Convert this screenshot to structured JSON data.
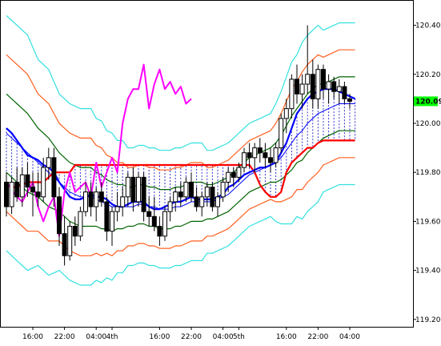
{
  "chart_data": {
    "type": "candlestick",
    "y_axis": {
      "ylim": [
        119.17,
        120.5
      ],
      "ticks": [
        "120.40",
        "120.20",
        "120.00",
        "119.80",
        "119.60",
        "119.40",
        "119.20"
      ]
    },
    "x_axis": {
      "tick_labels": [
        {
          "label": "16:00",
          "i": 5
        },
        {
          "label": "22:00",
          "i": 11
        },
        {
          "label": "04:00",
          "i": 17
        },
        {
          "label": "4th",
          "i": 20
        },
        {
          "label": "16:00",
          "i": 29
        },
        {
          "label": "22:00",
          "i": 35
        },
        {
          "label": "04:00",
          "i": 41
        },
        {
          "label": "5th",
          "i": 44
        },
        {
          "label": "16:00",
          "i": 53
        },
        {
          "label": "22:00",
          "i": 59
        },
        {
          "label": "04:00",
          "i": 65
        }
      ]
    },
    "current_price": {
      "label": "120.09",
      "value": 120.09,
      "color": "#00ff00"
    },
    "colors": {
      "up_candle": "#ffffff",
      "down_candle": "#000000",
      "conversion_line": "#0000ff",
      "base_line": "#ff0000",
      "lagging_span": "#ff00ff",
      "sma": "#0000ff",
      "band_1sigma": "#006400",
      "band_2sigma": "#ff6020",
      "band_3sigma": "#33e0e0",
      "cloud_hatch": "#3333cc"
    },
    "candles": [
      {
        "o": 119.76,
        "h": 119.8,
        "l": 119.62,
        "c": 119.66
      },
      {
        "o": 119.66,
        "h": 119.78,
        "l": 119.63,
        "c": 119.76
      },
      {
        "o": 119.76,
        "h": 119.82,
        "l": 119.68,
        "c": 119.7
      },
      {
        "o": 119.7,
        "h": 119.82,
        "l": 119.66,
        "c": 119.79
      },
      {
        "o": 119.79,
        "h": 119.84,
        "l": 119.7,
        "c": 119.74
      },
      {
        "o": 119.74,
        "h": 119.8,
        "l": 119.62,
        "c": 119.72
      },
      {
        "o": 119.72,
        "h": 119.8,
        "l": 119.66,
        "c": 119.7
      },
      {
        "o": 119.7,
        "h": 119.86,
        "l": 119.68,
        "c": 119.82
      },
      {
        "o": 119.82,
        "h": 119.9,
        "l": 119.77,
        "c": 119.86
      },
      {
        "o": 119.86,
        "h": 119.9,
        "l": 119.66,
        "c": 119.7
      },
      {
        "o": 119.7,
        "h": 119.74,
        "l": 119.5,
        "c": 119.55
      },
      {
        "o": 119.55,
        "h": 119.62,
        "l": 119.42,
        "c": 119.46
      },
      {
        "o": 119.46,
        "h": 119.6,
        "l": 119.44,
        "c": 119.58
      },
      {
        "o": 119.58,
        "h": 119.62,
        "l": 119.5,
        "c": 119.54
      },
      {
        "o": 119.54,
        "h": 119.66,
        "l": 119.52,
        "c": 119.64
      },
      {
        "o": 119.64,
        "h": 119.76,
        "l": 119.62,
        "c": 119.72
      },
      {
        "o": 119.72,
        "h": 119.76,
        "l": 119.62,
        "c": 119.66
      },
      {
        "o": 119.66,
        "h": 119.74,
        "l": 119.6,
        "c": 119.72
      },
      {
        "o": 119.72,
        "h": 119.76,
        "l": 119.66,
        "c": 119.68
      },
      {
        "o": 119.68,
        "h": 119.7,
        "l": 119.52,
        "c": 119.56
      },
      {
        "o": 119.56,
        "h": 119.66,
        "l": 119.5,
        "c": 119.64
      },
      {
        "o": 119.64,
        "h": 119.72,
        "l": 119.6,
        "c": 119.66
      },
      {
        "o": 119.66,
        "h": 119.74,
        "l": 119.62,
        "c": 119.7
      },
      {
        "o": 119.7,
        "h": 119.8,
        "l": 119.66,
        "c": 119.78
      },
      {
        "o": 119.78,
        "h": 119.82,
        "l": 119.64,
        "c": 119.68
      },
      {
        "o": 119.68,
        "h": 119.8,
        "l": 119.66,
        "c": 119.78
      },
      {
        "o": 119.78,
        "h": 119.8,
        "l": 119.6,
        "c": 119.64
      },
      {
        "o": 119.64,
        "h": 119.7,
        "l": 119.58,
        "c": 119.62
      },
      {
        "o": 119.62,
        "h": 119.7,
        "l": 119.56,
        "c": 119.58
      },
      {
        "o": 119.58,
        "h": 119.62,
        "l": 119.5,
        "c": 119.54
      },
      {
        "o": 119.54,
        "h": 119.66,
        "l": 119.52,
        "c": 119.64
      },
      {
        "o": 119.64,
        "h": 119.7,
        "l": 119.6,
        "c": 119.68
      },
      {
        "o": 119.68,
        "h": 119.74,
        "l": 119.64,
        "c": 119.72
      },
      {
        "o": 119.72,
        "h": 119.76,
        "l": 119.66,
        "c": 119.7
      },
      {
        "o": 119.7,
        "h": 119.78,
        "l": 119.68,
        "c": 119.76
      },
      {
        "o": 119.76,
        "h": 119.8,
        "l": 119.68,
        "c": 119.7
      },
      {
        "o": 119.7,
        "h": 119.74,
        "l": 119.64,
        "c": 119.66
      },
      {
        "o": 119.66,
        "h": 119.72,
        "l": 119.62,
        "c": 119.7
      },
      {
        "o": 119.7,
        "h": 119.76,
        "l": 119.66,
        "c": 119.74
      },
      {
        "o": 119.74,
        "h": 119.76,
        "l": 119.64,
        "c": 119.66
      },
      {
        "o": 119.66,
        "h": 119.72,
        "l": 119.62,
        "c": 119.7
      },
      {
        "o": 119.7,
        "h": 119.78,
        "l": 119.68,
        "c": 119.76
      },
      {
        "o": 119.76,
        "h": 119.82,
        "l": 119.72,
        "c": 119.8
      },
      {
        "o": 119.8,
        "h": 119.82,
        "l": 119.74,
        "c": 119.78
      },
      {
        "o": 119.78,
        "h": 119.84,
        "l": 119.76,
        "c": 119.82
      },
      {
        "o": 119.82,
        "h": 119.9,
        "l": 119.8,
        "c": 119.88
      },
      {
        "o": 119.88,
        "h": 119.92,
        "l": 119.82,
        "c": 119.86
      },
      {
        "o": 119.86,
        "h": 119.92,
        "l": 119.8,
        "c": 119.9
      },
      {
        "o": 119.9,
        "h": 119.94,
        "l": 119.84,
        "c": 119.88
      },
      {
        "o": 119.88,
        "h": 119.92,
        "l": 119.82,
        "c": 119.86
      },
      {
        "o": 119.86,
        "h": 119.9,
        "l": 119.8,
        "c": 119.84
      },
      {
        "o": 119.84,
        "h": 119.92,
        "l": 119.82,
        "c": 119.9
      },
      {
        "o": 119.9,
        "h": 120.04,
        "l": 119.88,
        "c": 120.02
      },
      {
        "o": 120.02,
        "h": 120.1,
        "l": 119.96,
        "c": 120.06
      },
      {
        "o": 120.06,
        "h": 120.2,
        "l": 120.02,
        "c": 120.18
      },
      {
        "o": 120.18,
        "h": 120.24,
        "l": 120.08,
        "c": 120.12
      },
      {
        "o": 120.12,
        "h": 120.2,
        "l": 120.06,
        "c": 120.16
      },
      {
        "o": 120.16,
        "h": 120.4,
        "l": 120.12,
        "c": 120.2
      },
      {
        "o": 120.2,
        "h": 120.26,
        "l": 120.06,
        "c": 120.1
      },
      {
        "o": 120.1,
        "h": 120.24,
        "l": 120.06,
        "c": 120.22
      },
      {
        "o": 120.22,
        "h": 120.24,
        "l": 120.1,
        "c": 120.14
      },
      {
        "o": 120.14,
        "h": 120.2,
        "l": 120.08,
        "c": 120.17
      },
      {
        "o": 120.17,
        "h": 120.19,
        "l": 120.1,
        "c": 120.13
      },
      {
        "o": 120.13,
        "h": 120.18,
        "l": 120.08,
        "c": 120.15
      },
      {
        "o": 120.15,
        "h": 120.17,
        "l": 120.08,
        "c": 120.1
      },
      {
        "o": 120.1,
        "h": 120.12,
        "l": 120.06,
        "c": 120.09
      }
    ],
    "conversion_line": [
      119.98,
      119.96,
      119.93,
      119.9,
      119.87,
      119.86,
      119.85,
      119.83,
      119.82,
      119.8,
      119.76,
      119.73,
      119.7,
      119.69,
      119.69,
      119.7,
      119.71,
      119.7,
      119.7,
      119.69,
      119.67,
      119.66,
      119.66,
      119.67,
      119.68,
      119.68,
      119.68,
      119.66,
      119.65,
      119.65,
      119.66,
      119.67,
      119.68,
      119.68,
      119.69,
      119.7,
      119.69,
      119.69,
      119.69,
      119.69,
      119.7,
      119.71,
      119.74,
      119.75,
      119.77,
      119.79,
      119.8,
      119.81,
      119.82,
      119.82,
      119.83,
      119.84,
      119.88,
      119.92,
      119.98,
      120.04,
      120.07,
      120.1,
      120.12,
      120.13,
      120.14,
      120.14,
      120.14,
      120.13,
      120.12,
      120.11,
      120.1
    ],
    "base_line": [
      119.75,
      119.74,
      119.74,
      119.75,
      119.76,
      119.76,
      119.76,
      119.76,
      119.78,
      119.8,
      119.8,
      119.8,
      119.8,
      119.83,
      119.83,
      119.83,
      119.83,
      119.83,
      119.83,
      119.83,
      119.83,
      119.83,
      119.83,
      119.83,
      119.83,
      119.83,
      119.83,
      119.83,
      119.83,
      119.83,
      119.83,
      119.83,
      119.83,
      119.83,
      119.83,
      119.83,
      119.83,
      119.83,
      119.83,
      119.83,
      119.83,
      119.83,
      119.83,
      119.83,
      119.83,
      119.83,
      119.83,
      119.8,
      119.75,
      119.72,
      119.7,
      119.7,
      119.72,
      119.8,
      119.84,
      119.86,
      119.88,
      119.9,
      119.9,
      119.92,
      119.93,
      119.93,
      119.93,
      119.93,
      119.93,
      119.93,
      119.93
    ],
    "sma": [
      119.96,
      119.94,
      119.92,
      119.9,
      119.88,
      119.86,
      119.84,
      119.82,
      119.8,
      119.78,
      119.76,
      119.74,
      119.72,
      119.71,
      119.7,
      119.7,
      119.7,
      119.69,
      119.68,
      119.67,
      119.66,
      119.66,
      119.66,
      119.66,
      119.66,
      119.67,
      119.67,
      119.66,
      119.66,
      119.65,
      119.65,
      119.65,
      119.66,
      119.66,
      119.67,
      119.68,
      119.68,
      119.68,
      119.68,
      119.68,
      119.69,
      119.7,
      119.71,
      119.73,
      119.75,
      119.77,
      119.79,
      119.8,
      119.81,
      119.82,
      119.83,
      119.84,
      119.86,
      119.89,
      119.92,
      119.95,
      119.97,
      120.0,
      120.02,
      120.04,
      120.05,
      120.06,
      120.07,
      120.08,
      120.08,
      120.08,
      120.08
    ],
    "band_sigma_1": [
      0.16,
      0.16,
      0.16,
      0.16,
      0.16,
      0.15,
      0.14,
      0.14,
      0.14,
      0.13,
      0.12,
      0.12,
      0.12,
      0.12,
      0.12,
      0.12,
      0.12,
      0.11,
      0.11,
      0.1,
      0.1,
      0.09,
      0.09,
      0.08,
      0.08,
      0.08,
      0.08,
      0.08,
      0.08,
      0.08,
      0.08,
      0.08,
      0.08,
      0.08,
      0.08,
      0.08,
      0.08,
      0.08,
      0.07,
      0.07,
      0.07,
      0.07,
      0.07,
      0.07,
      0.07,
      0.07,
      0.07,
      0.07,
      0.07,
      0.07,
      0.07,
      0.08,
      0.09,
      0.1,
      0.11,
      0.11,
      0.12,
      0.12,
      0.12,
      0.12,
      0.11,
      0.11,
      0.11,
      0.11,
      0.11,
      0.11,
      0.11
    ],
    "lagging_span": [
      {
        "i": 0,
        "v": 119.76
      },
      {
        "i": 2,
        "v": 119.7
      },
      {
        "i": 3,
        "v": 119.68
      },
      {
        "i": 4,
        "v": 119.72
      },
      {
        "i": 5,
        "v": 119.76
      },
      {
        "i": 6,
        "v": 119.66
      },
      {
        "i": 7,
        "v": 119.6
      },
      {
        "i": 8,
        "v": 119.66
      },
      {
        "i": 9,
        "v": 119.7
      },
      {
        "i": 10,
        "v": 119.54
      },
      {
        "i": 11,
        "v": 119.72
      },
      {
        "i": 12,
        "v": 119.8
      },
      {
        "i": 13,
        "v": 119.72
      },
      {
        "i": 14,
        "v": 119.74
      },
      {
        "i": 15,
        "v": 119.76
      },
      {
        "i": 16,
        "v": 119.7
      },
      {
        "i": 17,
        "v": 119.84
      },
      {
        "i": 18,
        "v": 119.74
      },
      {
        "i": 19,
        "v": 119.8
      },
      {
        "i": 20,
        "v": 119.86
      },
      {
        "i": 21,
        "v": 119.8
      },
      {
        "i": 22,
        "v": 120.0
      },
      {
        "i": 23,
        "v": 120.1
      },
      {
        "i": 24,
        "v": 120.14
      },
      {
        "i": 25,
        "v": 120.14
      },
      {
        "i": 26,
        "v": 120.24
      },
      {
        "i": 27,
        "v": 120.06
      },
      {
        "i": 28,
        "v": 120.16
      },
      {
        "i": 29,
        "v": 120.22
      },
      {
        "i": 30,
        "v": 120.14
      },
      {
        "i": 31,
        "v": 120.17
      },
      {
        "i": 32,
        "v": 120.12
      },
      {
        "i": 33,
        "v": 120.15
      },
      {
        "i": 34,
        "v": 120.08
      },
      {
        "i": 35,
        "v": 120.1
      }
    ]
  }
}
